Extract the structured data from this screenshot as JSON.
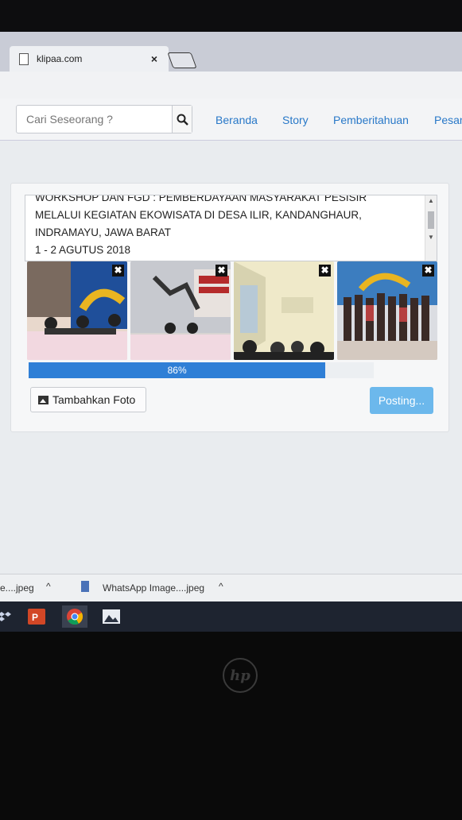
{
  "browser": {
    "tab_title": "klipaa.com",
    "tab_close": "×"
  },
  "navbar": {
    "search_placeholder": "Cari Seseorang ?",
    "links": [
      "Beranda",
      "Story",
      "Pemberitahuan",
      "Pesan"
    ]
  },
  "post": {
    "text": "WORKSHOP DAN FGD : PEMBERDAYAAN MASYARAKAT PESISIR\nMELALUI KEGIATAN EKOWISATA DI DESA ILIR, KANDANGHAUR,\nINDRAMAYU, JAWA BARAT\n1 - 2 AGUTUS 2018",
    "photos": [
      {
        "alt": "Workshop panel photo 1",
        "remove": "✖"
      },
      {
        "alt": "Workshop banner photo 2",
        "remove": "✖"
      },
      {
        "alt": "Room photo 3",
        "remove": "✖"
      },
      {
        "alt": "Group photo 4",
        "remove": "✖"
      }
    ],
    "upload_progress_label": "86%",
    "upload_progress": 0.86,
    "add_photo_label": "Tambahkan Foto",
    "submit_label": "Posting..."
  },
  "downloads": {
    "item1": "e....jpeg",
    "item2": "WhatsApp Image....jpeg"
  },
  "colors": {
    "accent": "#2f7fd6",
    "link": "#2878c8",
    "submit": "#6cb8ec"
  }
}
